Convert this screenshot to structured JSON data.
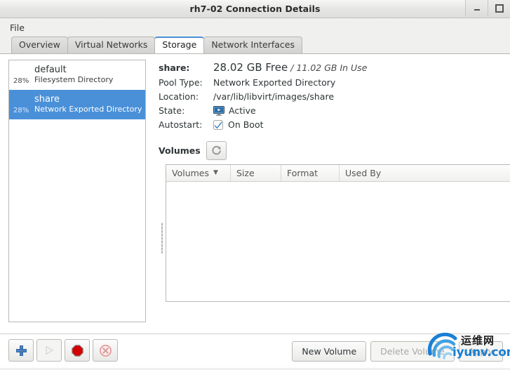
{
  "window": {
    "title": "rh7-02 Connection Details",
    "minimize_label": "Minimize",
    "maximize_label": "Maximize"
  },
  "menubar": {
    "items": [
      {
        "label": "File"
      }
    ]
  },
  "tabs": [
    {
      "label": "Overview",
      "active": false
    },
    {
      "label": "Virtual Networks",
      "active": false
    },
    {
      "label": "Storage",
      "active": true
    },
    {
      "label": "Network Interfaces",
      "active": false
    }
  ],
  "sidebar": {
    "pools": [
      {
        "percent": "28%",
        "name": "default",
        "type": "Filesystem Directory",
        "selected": false
      },
      {
        "percent": "28%",
        "name": "share",
        "type": "Network Exported Directory",
        "selected": true
      }
    ],
    "toolbar": [
      {
        "name": "add-pool",
        "icon": "plus-icon",
        "enabled": true
      },
      {
        "name": "start-pool",
        "icon": "play-icon",
        "enabled": false
      },
      {
        "name": "stop-pool",
        "icon": "stop-icon",
        "enabled": true
      },
      {
        "name": "delete-pool",
        "icon": "delete-icon",
        "enabled": true
      }
    ]
  },
  "details": {
    "pool_label": "share:",
    "free_text": "28.02 GB Free",
    "separator": "/",
    "inuse_text": "11.02 GB In Use",
    "pool_type_label": "Pool Type:",
    "pool_type_value": "Network Exported Directory",
    "location_label": "Location:",
    "location_value": "/var/lib/libvirt/images/share",
    "state_label": "State:",
    "state_value": "Active",
    "autostart_label": "Autostart:",
    "autostart_value": "On Boot",
    "autostart_checked": true
  },
  "volumes": {
    "title": "Volumes",
    "refresh_label": "Refresh",
    "columns": [
      {
        "label": "Volumes",
        "sorted": true,
        "sort_dir": "down"
      },
      {
        "label": "Size",
        "sorted": false
      },
      {
        "label": "Format",
        "sorted": false
      },
      {
        "label": "Used By",
        "sorted": false
      }
    ],
    "rows": []
  },
  "actions": {
    "new_volume": "New Volume",
    "delete_volume": "Delete Volume",
    "apply": "Apply"
  },
  "watermark": {
    "text": "运维网",
    "url": "iyunv.com"
  },
  "colors": {
    "selection_blue": "#4a90d9",
    "accent_blue": "#1a7fd4",
    "stop_red": "#cc0000",
    "window_bg": "#f0f0ef"
  }
}
